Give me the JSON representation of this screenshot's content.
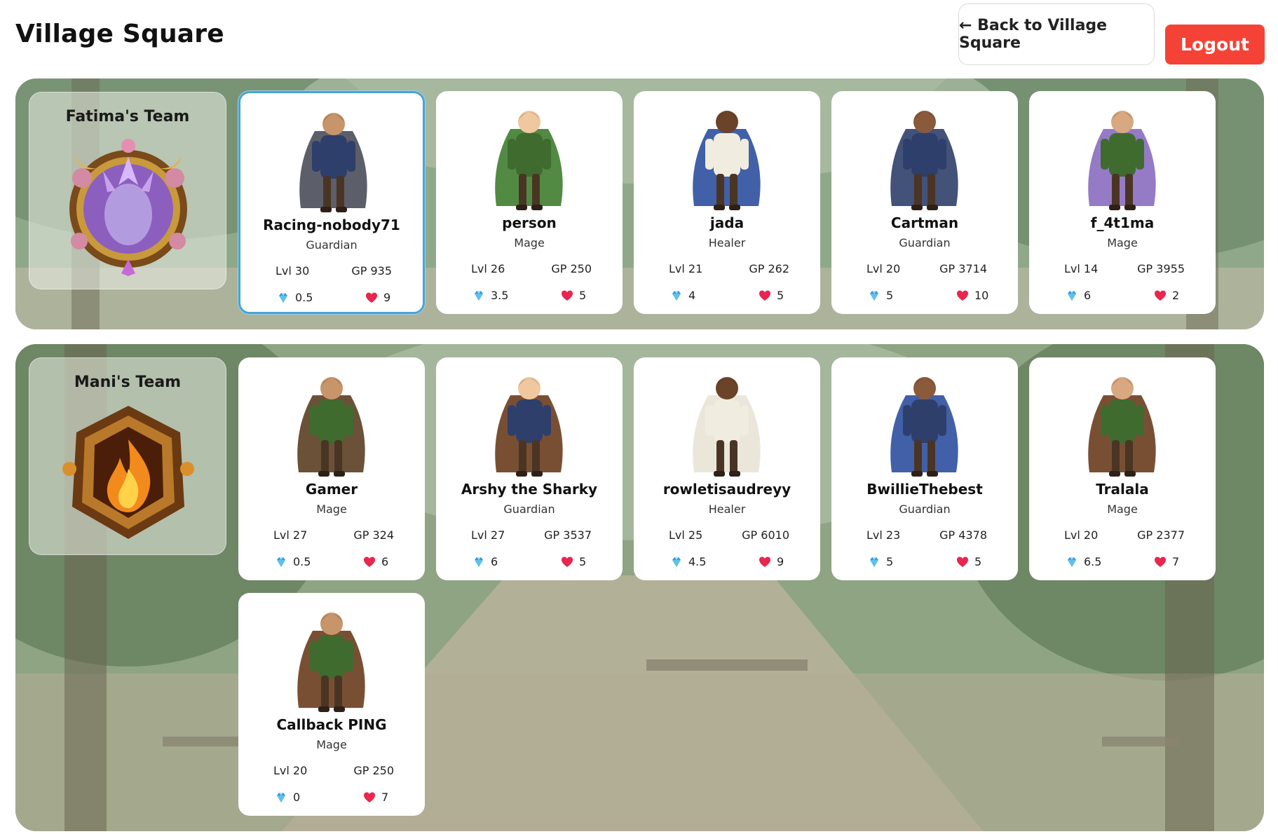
{
  "header": {
    "title": "Village Square",
    "back_label": "← Back to Village Square",
    "logout_label": "Logout"
  },
  "colors": {
    "logout": "#f44336",
    "selected_border": "#4aa3d6",
    "gem": "#2f9bdc",
    "heart": "#e8264f"
  },
  "teams": [
    {
      "name": "Fatima's Team",
      "emblem_icon": "violet-crystal-crest-icon",
      "members": [
        {
          "name": "Racing-nobody71",
          "class": "Guardian",
          "lvl": "Lvl 30",
          "gp": "GP 935",
          "gems": "0.5",
          "hearts": "9",
          "selected": true
        },
        {
          "name": "person",
          "class": "Mage",
          "lvl": "Lvl 26",
          "gp": "GP 250",
          "gems": "3.5",
          "hearts": "5"
        },
        {
          "name": "jada",
          "class": "Healer",
          "lvl": "Lvl 21",
          "gp": "GP 262",
          "gems": "4",
          "hearts": "5"
        },
        {
          "name": "Cartman",
          "class": "Guardian",
          "lvl": "Lvl 20",
          "gp": "GP 3714",
          "gems": "5",
          "hearts": "10"
        },
        {
          "name": "f_4t1ma",
          "class": "Mage",
          "lvl": "Lvl 14",
          "gp": "GP 3955",
          "gems": "6",
          "hearts": "2"
        }
      ]
    },
    {
      "name": "Mani's Team",
      "emblem_icon": "flame-crest-icon",
      "members": [
        {
          "name": "Gamer",
          "class": "Mage",
          "lvl": "Lvl 27",
          "gp": "GP 324",
          "gems": "0.5",
          "hearts": "6"
        },
        {
          "name": "Arshy the Sharky",
          "class": "Guardian",
          "lvl": "Lvl 27",
          "gp": "GP 3537",
          "gems": "6",
          "hearts": "5"
        },
        {
          "name": "rowletisaudreyy",
          "class": "Healer",
          "lvl": "Lvl 25",
          "gp": "GP 6010",
          "gems": "4.5",
          "hearts": "9"
        },
        {
          "name": "BwillieThebest",
          "class": "Guardian",
          "lvl": "Lvl 23",
          "gp": "GP 4378",
          "gems": "5",
          "hearts": "5"
        },
        {
          "name": "Tralala",
          "class": "Mage",
          "lvl": "Lvl 20",
          "gp": "GP 2377",
          "gems": "6.5",
          "hearts": "7"
        },
        {
          "name": "Callback PING",
          "class": "Mage",
          "lvl": "Lvl 20",
          "gp": "GP 250",
          "gems": "0",
          "hearts": "7"
        }
      ]
    }
  ]
}
